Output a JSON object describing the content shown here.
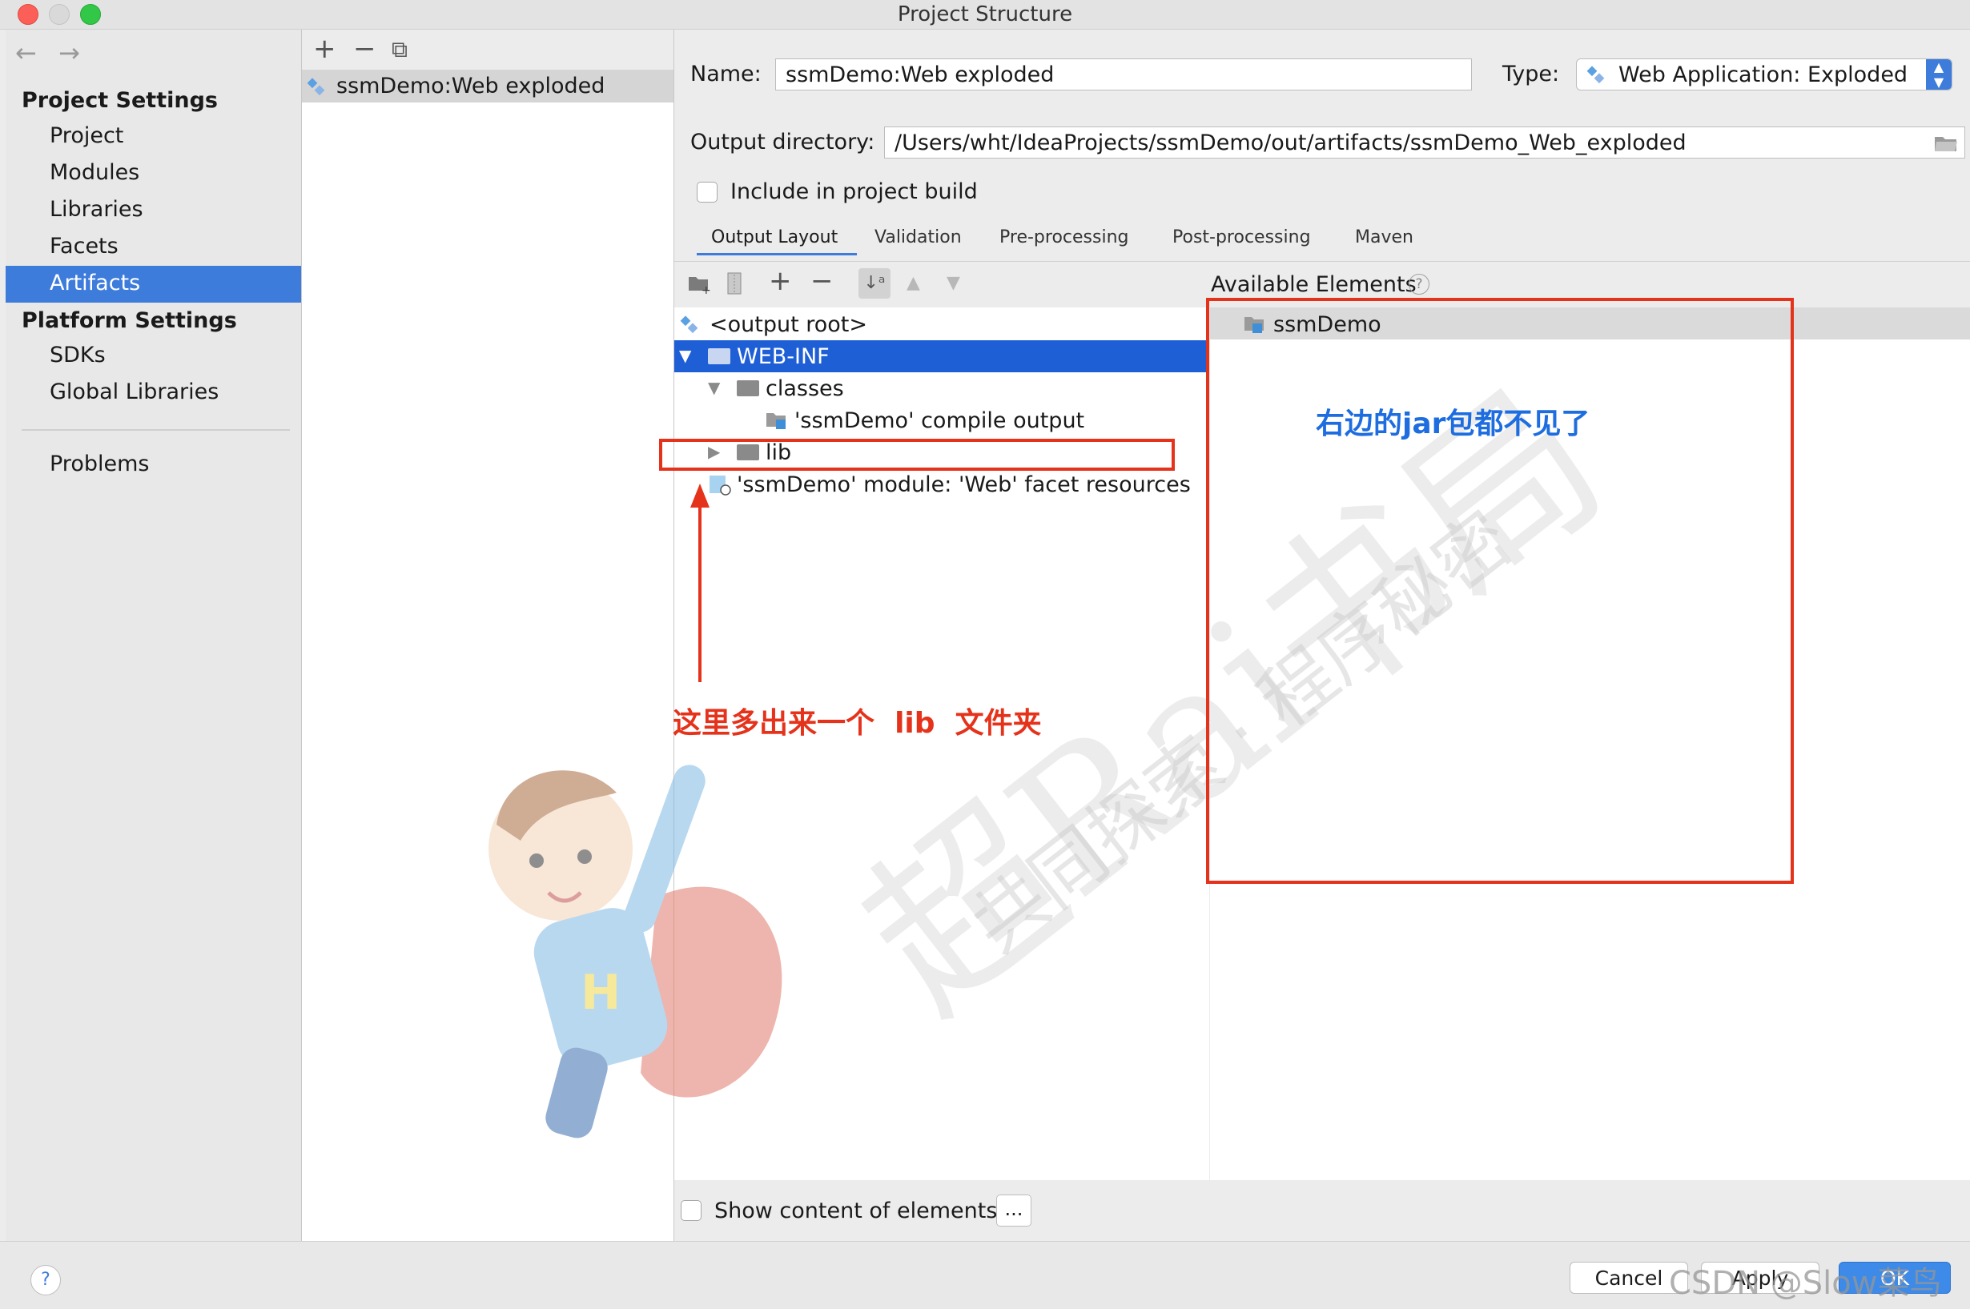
{
  "window": {
    "title": "Project Structure"
  },
  "nav": {
    "back": "←",
    "forward": "→",
    "project_settings_header": "Project Settings",
    "project_settings_items": [
      "Project",
      "Modules",
      "Libraries",
      "Facets",
      "Artifacts"
    ],
    "selected": "Artifacts",
    "platform_settings_header": "Platform Settings",
    "platform_settings_items": [
      "SDKs",
      "Global Libraries"
    ],
    "problems": "Problems"
  },
  "artifact_list": {
    "toolbar": {
      "add": "+",
      "remove": "−",
      "copy": "⧉"
    },
    "items": [
      "ssmDemo:Web exploded"
    ]
  },
  "artifact": {
    "name_label": "Name:",
    "name_value": "ssmDemo:Web exploded",
    "type_label": "Type:",
    "type_value": "Web Application: Exploded",
    "output_dir_label": "Output directory:",
    "output_dir_value": "/Users/wht/IdeaProjects/ssmDemo/out/artifacts/ssmDemo_Web_exploded",
    "include_label": "Include in project build",
    "include_checked": false
  },
  "tabs": [
    "Output Layout",
    "Validation",
    "Pre-processing",
    "Post-processing",
    "Maven"
  ],
  "active_tab": "Output Layout",
  "output_tree": {
    "root": "<output root>",
    "web_inf": "WEB-INF",
    "classes": "classes",
    "compile_output": "'ssmDemo' compile output",
    "lib": "lib",
    "facet_resources": "'ssmDemo' module: 'Web' facet resources"
  },
  "available": {
    "header": "Available Elements",
    "help": "?",
    "items": [
      "ssmDemo"
    ]
  },
  "annotations": {
    "right_note": "右边的jar包都不见了",
    "left_note": "这里多出来一个  lib  文件夹",
    "color_red": "#e5321b",
    "color_blue": "#1d6de0"
  },
  "footer": {
    "show_content_label": "Show content of elements",
    "more": "...",
    "help": "?",
    "cancel": "Cancel",
    "apply": "Apply",
    "ok": "OK"
  },
  "watermark": {
    "main": "超Rai书局",
    "sub": "共同探索 · 程序秘密",
    "csdn": "CSDN @Slow菜鸟"
  }
}
